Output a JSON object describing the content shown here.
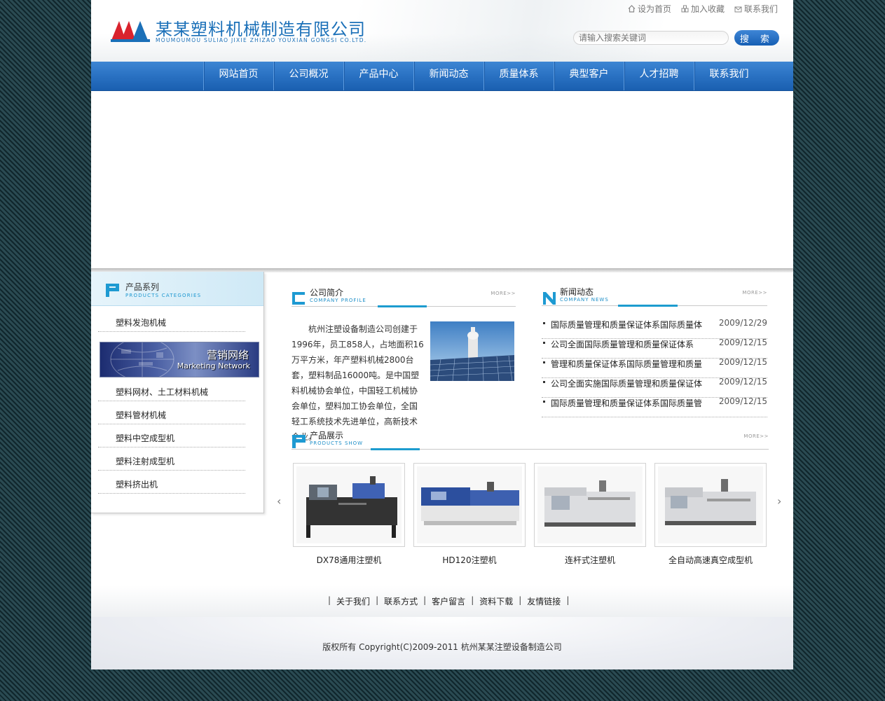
{
  "header": {
    "company_name": "某某塑料机械制造有限公司",
    "company_name_en": "MOUMOUMOU SULIAO JIXIE ZHIZAO YOUXIAN GONGSI CO.LTD.",
    "top_links": [
      "设为首页",
      "加入收藏",
      "联系我们"
    ],
    "search_placeholder": "请输入搜索关键词",
    "search_button": "搜 索"
  },
  "nav": {
    "items": [
      "网站首页",
      "公司概况",
      "产品中心",
      "新闻动态",
      "质量体系",
      "典型客户",
      "人才招聘",
      "联系我们"
    ]
  },
  "sidebar": {
    "title": "产品系列",
    "subtitle": "PRODUCTS CATEGORIES",
    "items": [
      "塑料发泡机械",
      "塑料网材、土工材料机械",
      "塑料管材机械",
      "塑料中空成型机",
      "塑料注射成型机",
      "塑料挤出机"
    ],
    "marketing_cn": "营销网络",
    "marketing_en": "Marketing Network"
  },
  "profile": {
    "title": "公司简介",
    "subtitle": "COMPANY PROFILE",
    "more": "MORE>>",
    "text": "杭州注塑设备制造公司创建于1996年，员工858人，占地面积16万平方米，年产塑料机械2800台套，塑料制品16000吨。是中国塑料机械协会单位，中国轻工机械协会单位，塑料加工协会单位，全国轻工系统技术先进单位，高新技术企业。"
  },
  "news": {
    "title": "新闻动态",
    "subtitle": "COMPANY NEWS",
    "more": "MORE>>",
    "items": [
      {
        "title": "国际质量管理和质量保证体系国际质量体",
        "date": "2009/12/29"
      },
      {
        "title": "公司全面国际质量管理和质量保证体系",
        "date": "2009/12/15"
      },
      {
        "title": "管理和质量保证体系国际质量管理和质量",
        "date": "2009/12/15"
      },
      {
        "title": "公司全面实施国际质量管理和质量保证体",
        "date": "2009/12/15"
      },
      {
        "title": "国际质量管理和质量保证体系国际质量管",
        "date": "2009/12/15"
      }
    ]
  },
  "products": {
    "title": "产品展示",
    "subtitle": "PRODUCTS SHOW",
    "more": "MORE>>",
    "items": [
      "DX78通用注塑机",
      "HD120注塑机",
      "连杆式注塑机",
      "全自动高速真空成型机"
    ],
    "prev": "‹",
    "next": "›"
  },
  "footer": {
    "links": [
      "关于我们",
      "联系方式",
      "客户留言",
      "资料下载",
      "友情链接"
    ],
    "copyright": "版权所有 Copyright(C)2009-2011 杭州某某注塑设备制造公司"
  },
  "colors": {
    "brand_blue": "#1b70b8",
    "nav_blue": "#2b73c4",
    "accent_cyan": "#1d9ccf",
    "logo_red": "#d9232d"
  }
}
